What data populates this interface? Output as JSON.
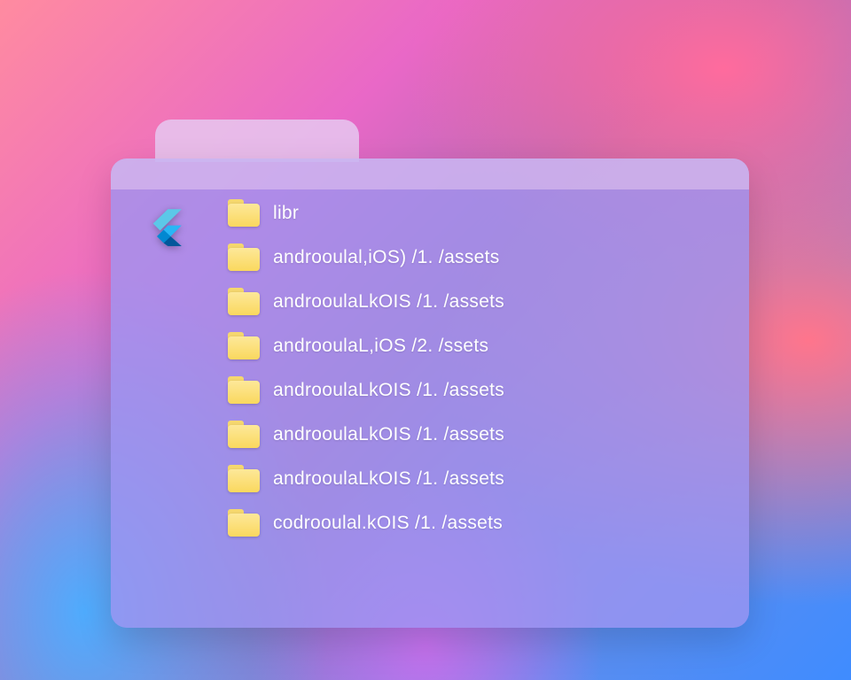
{
  "folder": {
    "items": [
      {
        "label": "libr"
      },
      {
        "label": "androoulal,iOS) /1. /assets"
      },
      {
        "label": "androoulaLkOIS /1. /assets"
      },
      {
        "label": "androoulaL,iOS /2. /ssets"
      },
      {
        "label": "androoulaLkOIS /1. /assets"
      },
      {
        "label": "androoulaLkOIS /1. /assets"
      },
      {
        "label": "androoulaLkOIS /1. /assets"
      },
      {
        "label": "codrooulal.kOIS /1. /assets"
      }
    ]
  }
}
